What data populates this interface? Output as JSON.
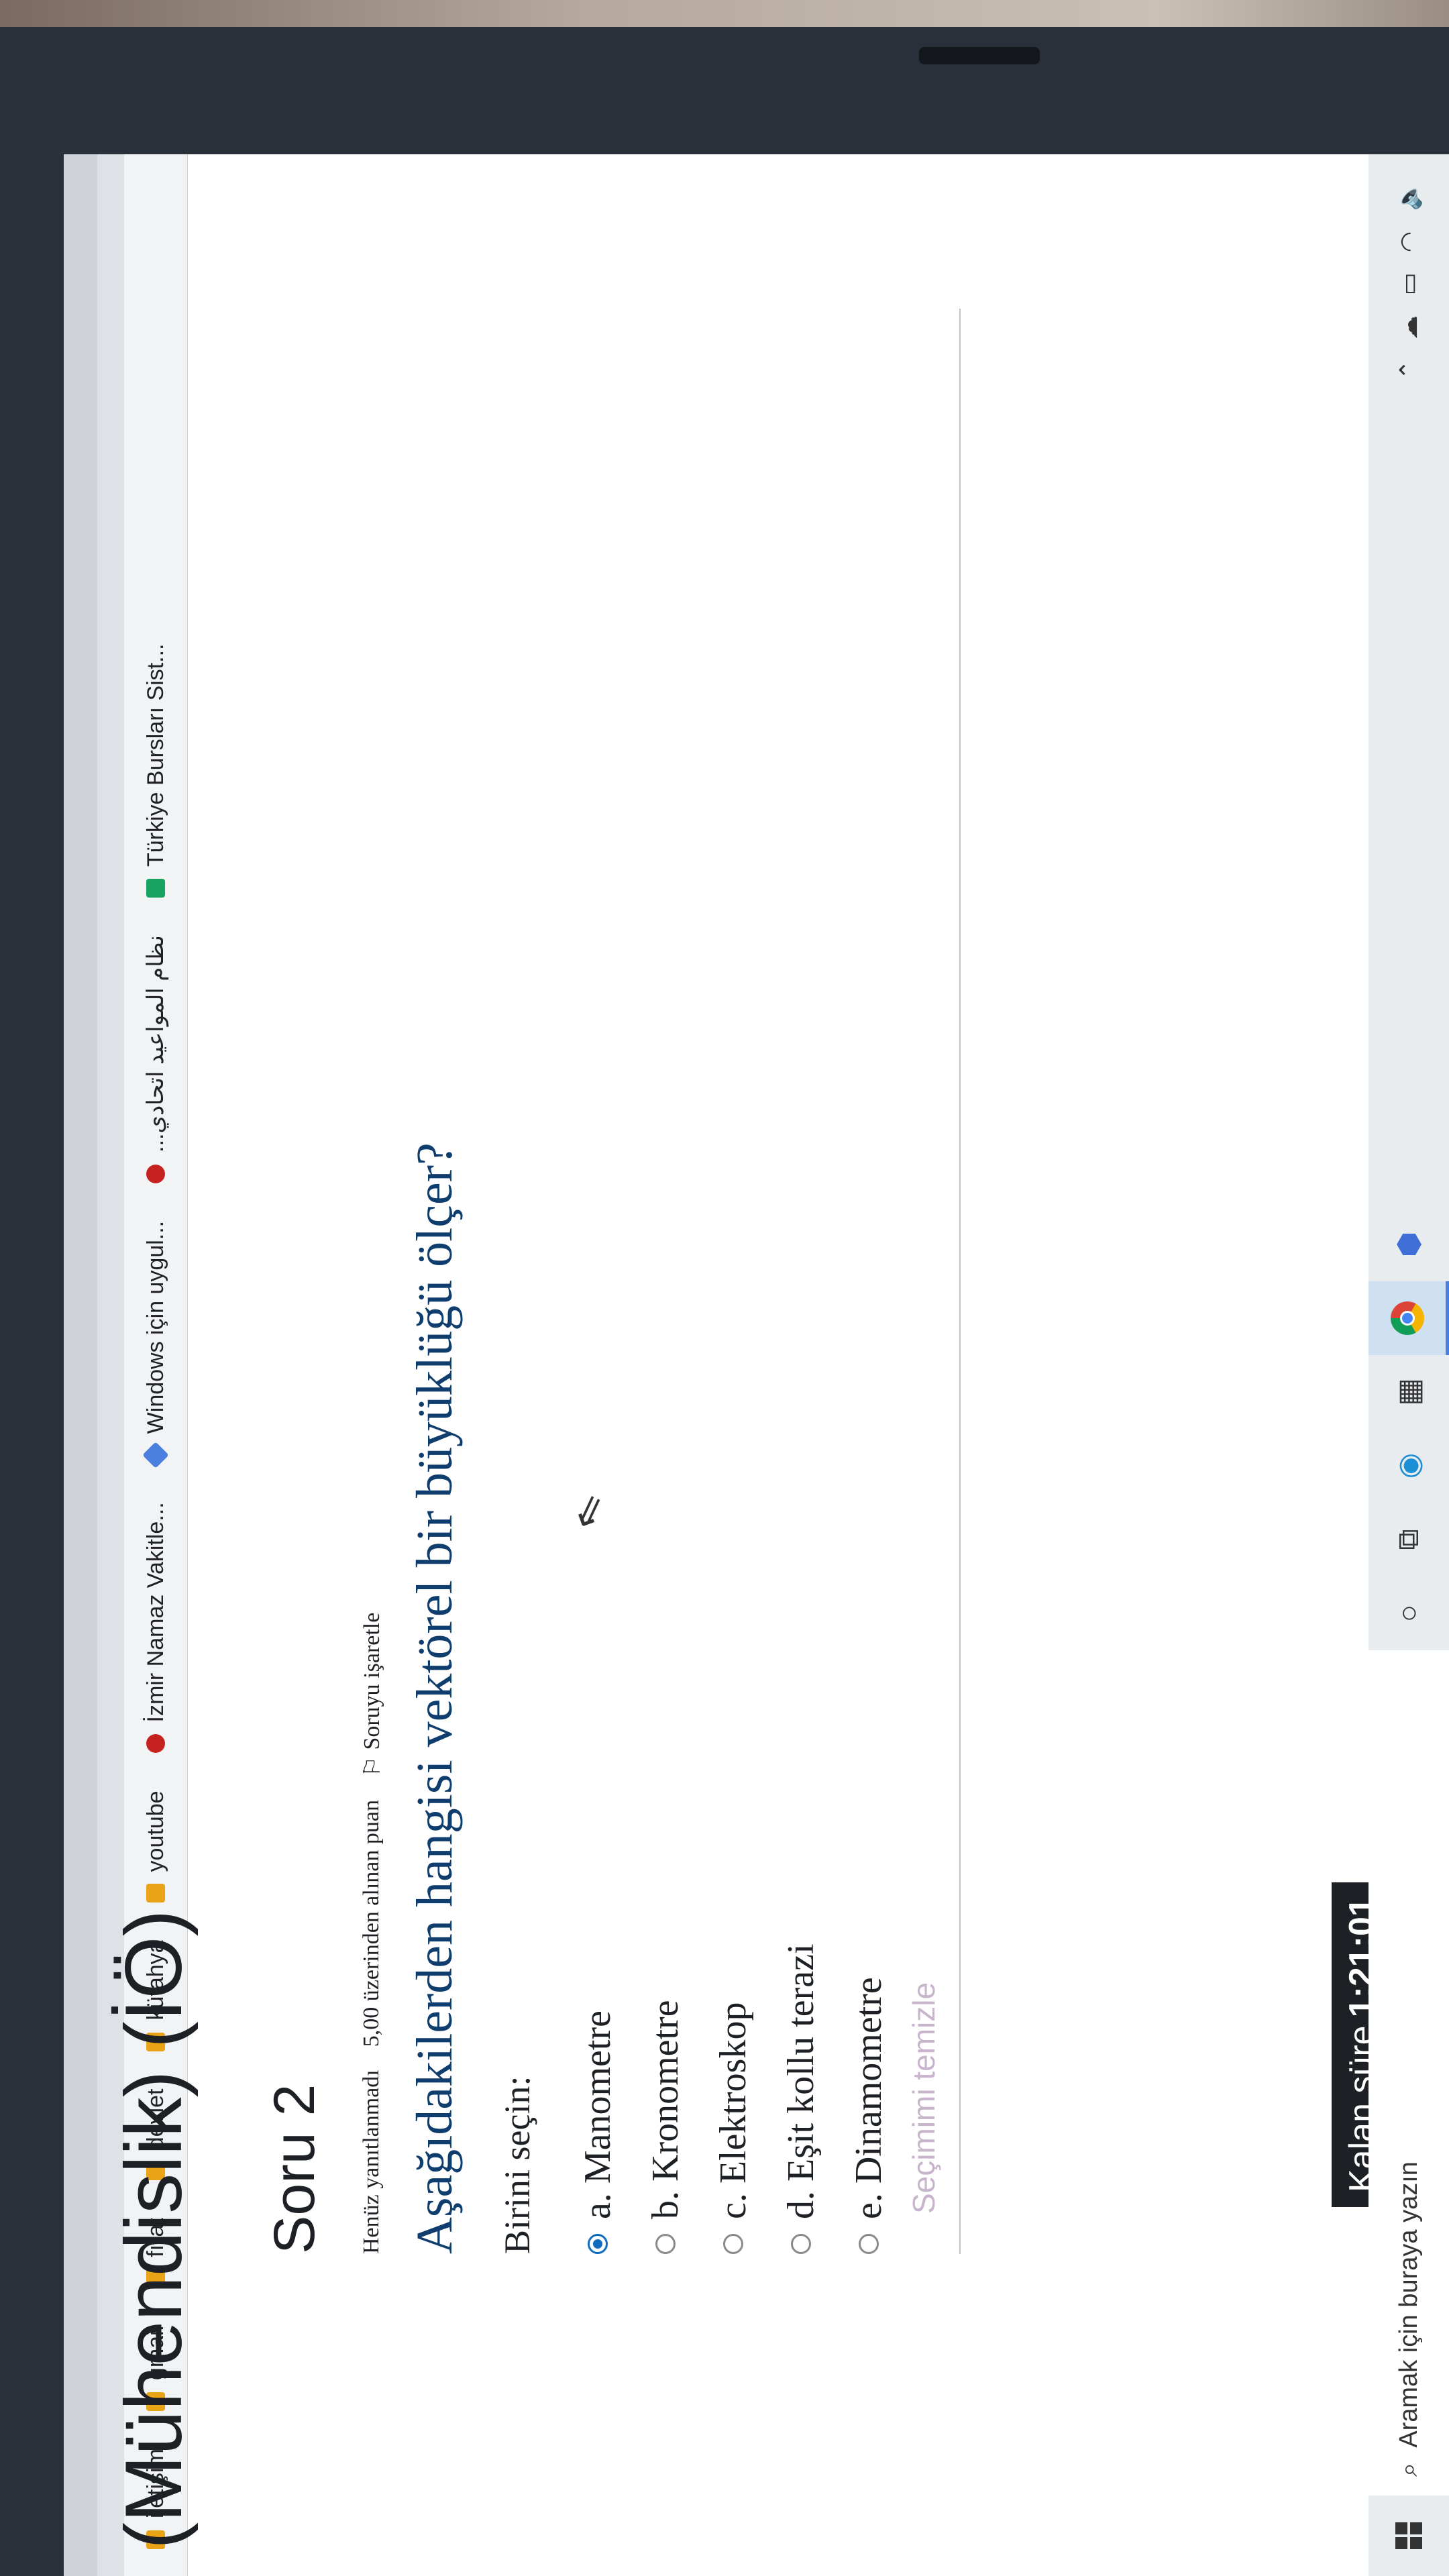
{
  "bookmarks": [
    {
      "label": "iletişim",
      "icon": "folder-icon"
    },
    {
      "label": "gmail",
      "icon": "folder-icon"
    },
    {
      "label": "fırat",
      "icon": "folder-icon"
    },
    {
      "label": "devlet",
      "icon": "folder-icon"
    },
    {
      "label": "kütahya",
      "icon": "folder-icon"
    },
    {
      "label": "youtube",
      "icon": "folder-icon"
    },
    {
      "label": "İzmir Namaz Vakitle...",
      "icon": "red-circle-icon"
    },
    {
      "label": "Windows için uygul...",
      "icon": "diamond-icon"
    },
    {
      "label": "...نظام المواعيد اتحادي",
      "icon": "red-logo-icon"
    },
    {
      "label": "Türkiye Bursları Sist...",
      "icon": "green-logo-icon"
    }
  ],
  "course_title": "(Mühendislik) (İÖ)",
  "question": {
    "title": "Soru 2",
    "status": "Henüz yanıtlanmadı",
    "points": "5,00 üzerinden alınan puan",
    "flag_label": "Soruyu işaretle",
    "text": "Aşağıdakilerden hangisi vektörel bir büyüklüğü ölçer?",
    "prompt": "Birini seçin:",
    "options": [
      {
        "label": "a. Manometre",
        "selected": true
      },
      {
        "label": "b. Kronometre",
        "selected": false
      },
      {
        "label": "c. Elektroskop",
        "selected": false
      },
      {
        "label": "d. Eşit kollu terazi",
        "selected": false
      },
      {
        "label": "e. Dinamometre",
        "selected": false
      }
    ],
    "clear_label": "Seçimimi temizle"
  },
  "timer": {
    "label": "Kalan süre",
    "value": "1:21:01"
  },
  "taskbar": {
    "search_placeholder": "Aramak için buraya yazın"
  },
  "colors": {
    "accent": "#0f6cbf",
    "question_text": "#0f3d6e",
    "timer_bg": "#1d2125"
  }
}
